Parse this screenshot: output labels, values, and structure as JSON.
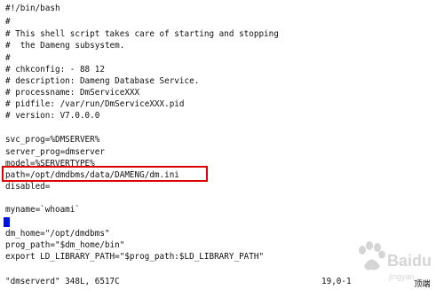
{
  "editor": {
    "lines": [
      "#!/bin/bash",
      "#",
      "# This shell script takes care of starting and stopping",
      "#  the Dameng subsystem.",
      "#",
      "# chkconfig: - 88 12",
      "# description: Dameng Database Service.",
      "# processname: DmServiceXXX",
      "# pidfile: /var/run/DmServiceXXX.pid",
      "# version: V7.0.0.0",
      "",
      "svc_prog=%DMSERVER%",
      "server_prog=dmserver",
      "model=%SERVERTYPE%",
      "path=/opt/dmdbms/data/DAMENG/dm.ini",
      "disabled=",
      "",
      "myname=`whoami`",
      "",
      "dm_home=\"/opt/dmdbms\"",
      "prog_path=\"$dm_home/bin\"",
      "export LD_LIBRARY_PATH=\"$prog_path:$LD_LIBRARY_PATH\""
    ]
  },
  "status_bar": {
    "file_info": "\"dmserverd\" 348L, 6517C",
    "position": "19,0-1",
    "scroll": "顶端"
  },
  "colors": {
    "highlight_border": "#e00000",
    "cursor": "#0011dd"
  }
}
